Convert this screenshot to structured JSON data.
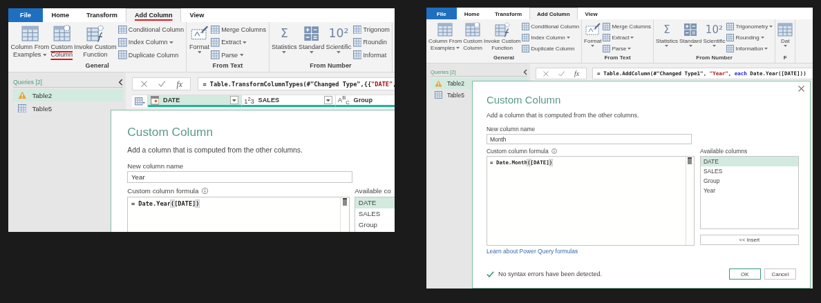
{
  "panels": [
    {
      "tabs": [
        {
          "label": "File",
          "kind": "file",
          "selected": false,
          "marked": false
        },
        {
          "label": "Home",
          "kind": "tab",
          "selected": false,
          "marked": false
        },
        {
          "label": "Transform",
          "kind": "tab",
          "selected": false,
          "marked": false
        },
        {
          "label": "Add Column",
          "kind": "tab",
          "selected": true,
          "marked": true
        },
        {
          "label": "View",
          "kind": "tab",
          "selected": false,
          "marked": false
        }
      ],
      "groups": [
        {
          "label": "General",
          "large": [
            {
              "kind": "table",
              "lines": [
                "Column From",
                "Examples"
              ],
              "dropdown": true,
              "marked": false
            },
            {
              "kind": "table-gear",
              "lines": [
                "Custom",
                "Column"
              ],
              "dropdown": false,
              "marked": true
            },
            {
              "kind": "function",
              "lines": [
                "Invoke Custom",
                "Function"
              ],
              "dropdown": false,
              "marked": false
            }
          ],
          "small": [
            {
              "label": "Conditional Column",
              "dropdown": false
            },
            {
              "label": "Index Column",
              "dropdown": true
            },
            {
              "label": "Duplicate Column",
              "dropdown": false
            }
          ]
        },
        {
          "label": "From Text",
          "large": [
            {
              "kind": "format",
              "lines": [
                "Format"
              ],
              "dropdown": true,
              "marked": false
            }
          ],
          "small": [
            {
              "label": "Merge Columns",
              "dropdown": false
            },
            {
              "label": "Extract",
              "dropdown": true
            },
            {
              "label": "Parse",
              "dropdown": true
            }
          ]
        },
        {
          "label": "From Number",
          "large": [
            {
              "kind": "glyph",
              "glyph": "Σ",
              "lines": [
                "Statistics"
              ],
              "dropdown": true,
              "marked": false
            },
            {
              "kind": "grid-ops",
              "lines": [
                "Standard"
              ],
              "dropdown": true,
              "marked": false
            },
            {
              "kind": "glyph",
              "glyph": "10²",
              "lines": [
                "Scientific"
              ],
              "dropdown": true,
              "marked": false
            }
          ],
          "small": [
            {
              "label": "Trigonom",
              "dropdown": false
            },
            {
              "label": "Roundin",
              "dropdown": false
            },
            {
              "label": "Informat",
              "dropdown": false
            }
          ]
        }
      ],
      "queries": {
        "title": "Queries [2]",
        "items": [
          {
            "label": "Table2",
            "kind": "warning",
            "selected": true
          },
          {
            "label": "Table5",
            "kind": "table",
            "selected": false
          }
        ]
      },
      "formula_bar": {
        "fx": "fx",
        "tokens": [
          {
            "text": "= Table.TransformColumnTypes(#\"Changed Type\",{{",
            "kind": "plain"
          },
          {
            "text": "\"DATE\"",
            "kind": "string"
          },
          {
            "text": ",",
            "kind": "plain"
          }
        ]
      },
      "columns": [
        {
          "kind": "date",
          "name": "DATE",
          "selected": true
        },
        {
          "kind": "number",
          "type_label": "1$^{2}$3",
          "name": "SALES",
          "selected": false
        },
        {
          "kind": "text",
          "type_label": "A$^{B}$$_{C}$",
          "name": "Group",
          "selected": false
        }
      ],
      "dialog": {
        "title": "Custom Column",
        "description": "Add a column that is computed from the other columns.",
        "name_label": "New column name",
        "name_value": "Year",
        "formula_label": "Custom column formula",
        "formula": [
          {
            "text": "= Date.Year",
            "kind": "plain"
          },
          {
            "text": "(",
            "kind": "match"
          },
          {
            "text": "[DATE]",
            "kind": "plain"
          },
          {
            "text": ")",
            "kind": "match"
          }
        ],
        "available_label": "Available co",
        "available": [
          {
            "name": "DATE",
            "selected": true
          },
          {
            "name": "SALES",
            "selected": false
          },
          {
            "name": "Group",
            "selected": false
          }
        ]
      }
    },
    {
      "tabs": [
        {
          "label": "File",
          "kind": "file",
          "selected": false,
          "marked": false
        },
        {
          "label": "Home",
          "kind": "tab",
          "selected": false,
          "marked": false
        },
        {
          "label": "Transform",
          "kind": "tab",
          "selected": false,
          "marked": false
        },
        {
          "label": "Add Column",
          "kind": "tab",
          "selected": true,
          "marked": false
        },
        {
          "label": "View",
          "kind": "tab",
          "selected": false,
          "marked": false
        }
      ],
      "groups": [
        {
          "label": "General",
          "large": [
            {
              "kind": "table",
              "lines": [
                "Column From",
                "Examples"
              ],
              "dropdown": true,
              "marked": false
            },
            {
              "kind": "table-gear",
              "lines": [
                "Custom",
                "Column"
              ],
              "dropdown": false,
              "marked": false
            },
            {
              "kind": "function",
              "lines": [
                "Invoke Custom",
                "Function"
              ],
              "dropdown": false,
              "marked": false
            }
          ],
          "small": [
            {
              "label": "Conditional Column",
              "dropdown": false
            },
            {
              "label": "Index Column",
              "dropdown": true
            },
            {
              "label": "Duplicate Column",
              "dropdown": false
            }
          ]
        },
        {
          "label": "From Text",
          "large": [
            {
              "kind": "format",
              "lines": [
                "Format"
              ],
              "dropdown": true,
              "marked": false
            }
          ],
          "small": [
            {
              "label": "Merge Columns",
              "dropdown": false
            },
            {
              "label": "Extract",
              "dropdown": true
            },
            {
              "label": "Parse",
              "dropdown": true
            }
          ]
        },
        {
          "label": "From Number",
          "large": [
            {
              "kind": "glyph",
              "glyph": "Σ",
              "lines": [
                "Statistics"
              ],
              "dropdown": true,
              "marked": false
            },
            {
              "kind": "grid-ops",
              "lines": [
                "Standard"
              ],
              "dropdown": true,
              "marked": false
            },
            {
              "kind": "glyph",
              "glyph": "10²",
              "lines": [
                "Scientific"
              ],
              "dropdown": true,
              "marked": false
            }
          ],
          "small": [
            {
              "label": "Trigonometry",
              "dropdown": true
            },
            {
              "label": "Rounding",
              "dropdown": true
            },
            {
              "label": "Information",
              "dropdown": true
            }
          ]
        },
        {
          "label": "F",
          "large": [
            {
              "kind": "table",
              "lines": [
                "Dat"
              ],
              "dropdown": true,
              "marked": false
            }
          ]
        }
      ],
      "queries": {
        "title": "Queries [2]",
        "items": [
          {
            "label": "Table2",
            "kind": "warning",
            "selected": true
          },
          {
            "label": "Table5",
            "kind": "table",
            "selected": false
          }
        ]
      },
      "formula_bar": {
        "fx": "fx",
        "tokens": [
          {
            "text": "= Table.AddColumn(#\"Changed Type1\", ",
            "kind": "plain"
          },
          {
            "text": "\"Year\"",
            "kind": "string"
          },
          {
            "text": ", ",
            "kind": "plain"
          },
          {
            "text": "each",
            "kind": "keyword"
          },
          {
            "text": " Date.Year([DATE]))",
            "kind": "plain"
          }
        ]
      },
      "dialog": {
        "closable": true,
        "title": "Custom Column",
        "description": "Add a column that is computed from the other columns.",
        "name_label": "New column name",
        "name_value": "Month",
        "formula_label": "Custom column formula",
        "formula": [
          {
            "text": "= Date.Month",
            "kind": "plain"
          },
          {
            "text": "(",
            "kind": "match"
          },
          {
            "text": "[DATE]",
            "kind": "plain"
          },
          {
            "text": ")",
            "kind": "match"
          }
        ],
        "available_label": "Available columns",
        "available": [
          {
            "name": "DATE",
            "selected": true
          },
          {
            "name": "SALES",
            "selected": false
          },
          {
            "name": "Group",
            "selected": false
          },
          {
            "name": "Year",
            "selected": false
          }
        ],
        "insert_label": "<< Insert",
        "link": "Learn about Power Query formulas",
        "status": "No syntax errors have been detected.",
        "buttons": [
          {
            "label": "OK",
            "primary": true
          },
          {
            "label": "Cancel",
            "primary": false
          }
        ]
      }
    }
  ]
}
